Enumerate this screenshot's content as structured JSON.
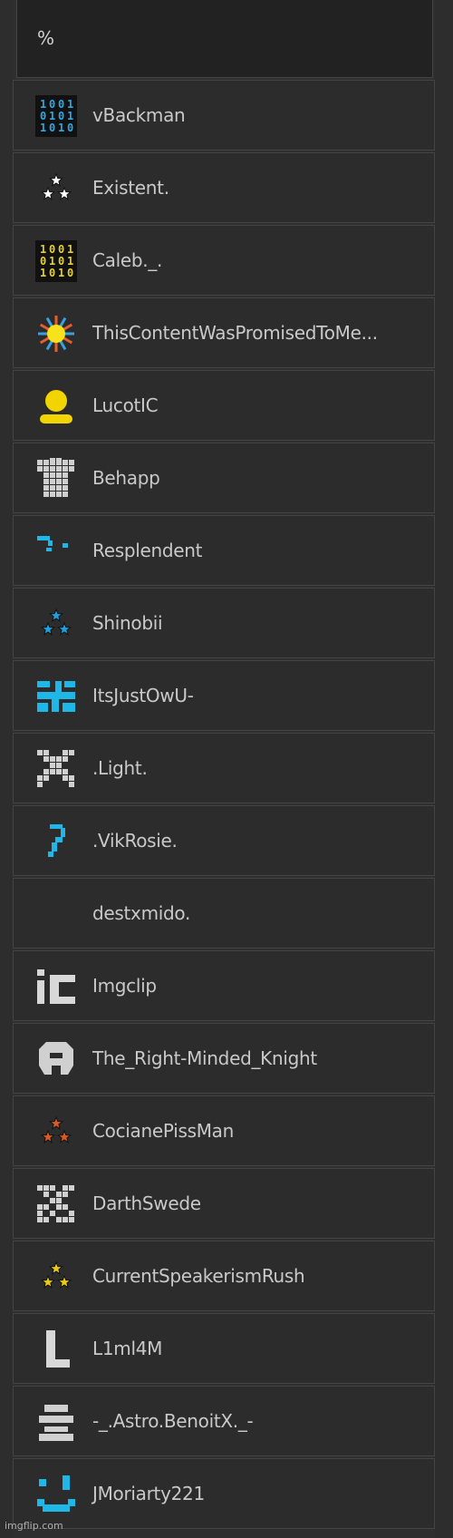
{
  "header": {
    "label": "%"
  },
  "members": [
    {
      "name": "vBackman",
      "avatar": "binary-blue-icon",
      "color": "#2aa9e6"
    },
    {
      "name": "Existent.",
      "avatar": "stars-white-icon",
      "color": "#ffffff"
    },
    {
      "name": "Caleb._.",
      "avatar": "binary-yellow-icon",
      "color": "#e9d21a"
    },
    {
      "name": "ThisContentWasPromisedToMe...",
      "avatar": "sun-burst-icon",
      "color": "#f7e21c"
    },
    {
      "name": "LucotIC",
      "avatar": "person-yellow-icon",
      "color": "#f2d500"
    },
    {
      "name": "Behapp",
      "avatar": "shirt-grey-icon",
      "color": "#cfcfcf"
    },
    {
      "name": "Resplendent",
      "avatar": "pixel-dots-blue-icon",
      "color": "#1fb7e8"
    },
    {
      "name": "Shinobii",
      "avatar": "stars-blue-icon",
      "color": "#1fa0e0"
    },
    {
      "name": "ItsJustOwU-",
      "avatar": "maze-blue-icon",
      "color": "#1fb7e8"
    },
    {
      "name": ".Light.",
      "avatar": "x-grey-icon",
      "color": "#d0d0d0"
    },
    {
      "name": ".VikRosie.",
      "avatar": "question-blue-icon",
      "color": "#1fb7e8"
    },
    {
      "name": "destxmido.",
      "avatar": "none",
      "color": "#2c2c2c"
    },
    {
      "name": "Imgclip",
      "avatar": "ic-grey-icon",
      "color": "#d8d8d8"
    },
    {
      "name": "The_Right-Minded_Knight",
      "avatar": "helmet-grey-icon",
      "color": "#d0d0d0"
    },
    {
      "name": "CocianePissMan",
      "avatar": "stars-orange-icon",
      "color": "#d85b24"
    },
    {
      "name": "DarthSwede",
      "avatar": "checker-grey-icon",
      "color": "#d0d0d0"
    },
    {
      "name": "CurrentSpeakerismRush",
      "avatar": "stars-yellow-icon",
      "color": "#e8cc18"
    },
    {
      "name": "L1ml4M",
      "avatar": "l-grey-icon",
      "color": "#d8d8d8"
    },
    {
      "name": "-_.Astro.BenoitX._-",
      "avatar": "stack-grey-icon",
      "color": "#d0d0d0"
    },
    {
      "name": "JMoriarty221",
      "avatar": "smile-blue-icon",
      "color": "#1fb7e8"
    }
  ],
  "watermark": "imgflip.com"
}
